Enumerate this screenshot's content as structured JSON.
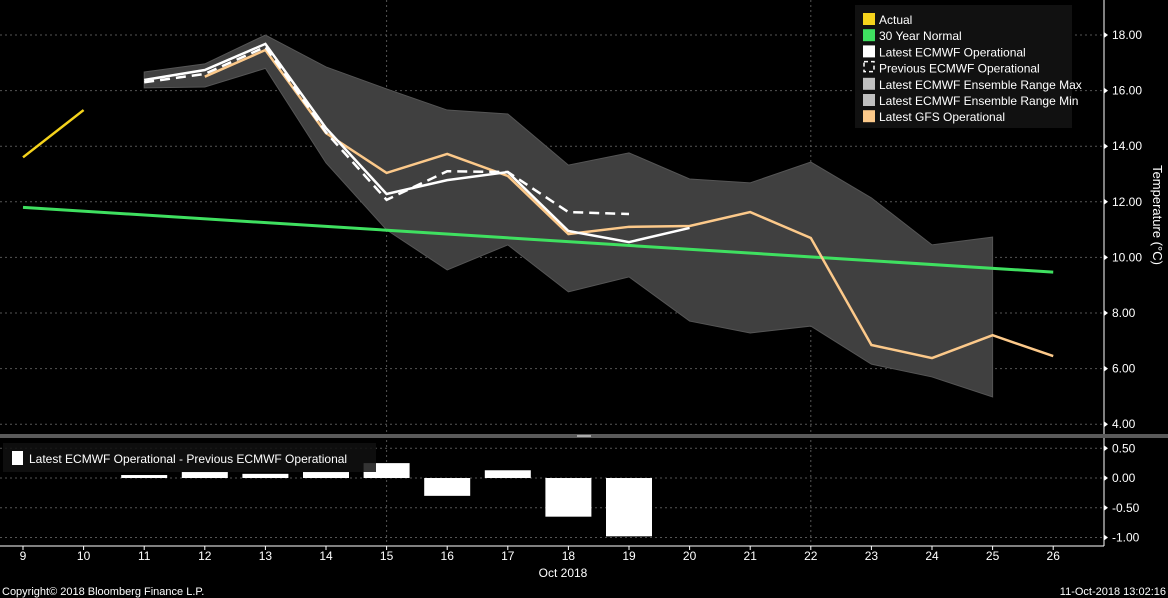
{
  "chart_data": [
    {
      "type": "line",
      "title": "",
      "ylabel": "Temperature (°C)",
      "ylim": [
        3.6,
        18.8
      ],
      "yticks": [
        "18.00",
        "16.00",
        "14.00",
        "12.00",
        "10.00",
        "8.00",
        "6.00",
        "4.00"
      ],
      "ytick_values": [
        18,
        16,
        14,
        12,
        10,
        8,
        6,
        4
      ],
      "legend_position": "top-right",
      "grid": true,
      "series": [
        {
          "name": "Actual",
          "color": "#f5d31c",
          "x": [
            9,
            10
          ],
          "values": [
            13.6,
            15.3
          ]
        },
        {
          "name": "30 Year Normal",
          "color": "#3fe060",
          "x": [
            9,
            26
          ],
          "values": [
            11.8,
            9.47
          ]
        },
        {
          "name": "Latest ECMWF Operational",
          "color": "#ffffff",
          "x": [
            11,
            12,
            13,
            14,
            15,
            16,
            17,
            18,
            19,
            20
          ],
          "values": [
            16.38,
            16.74,
            17.68,
            14.65,
            12.28,
            12.78,
            13.07,
            10.95,
            10.55,
            11.06
          ]
        },
        {
          "name": "Previous ECMWF Operational",
          "color": "#ffffff",
          "dashed": true,
          "x": [
            11,
            12,
            13,
            14,
            15,
            16,
            17,
            18,
            19
          ],
          "values": [
            16.3,
            16.6,
            17.57,
            14.5,
            12.07,
            13.1,
            13.07,
            11.63,
            11.56
          ]
        },
        {
          "name": "Latest ECMWF Ensemble Range Max",
          "color": "#c0c0c0",
          "x": [
            11,
            12,
            13,
            14,
            15,
            16,
            17,
            18,
            19,
            20,
            21,
            22,
            23,
            24,
            25
          ],
          "values": [
            16.67,
            16.96,
            18.0,
            16.85,
            16.06,
            15.3,
            15.16,
            13.32,
            13.76,
            12.82,
            12.68,
            13.43,
            12.14,
            10.45,
            10.73
          ]
        },
        {
          "name": "Latest ECMWF Ensemble Range Min",
          "color": "#c0c0c0",
          "x": [
            11,
            12,
            13,
            14,
            15,
            16,
            17,
            18,
            19,
            20,
            21,
            22,
            23,
            24,
            25
          ],
          "values": [
            16.1,
            16.13,
            16.8,
            13.4,
            10.99,
            9.55,
            10.45,
            8.76,
            9.3,
            7.71,
            7.28,
            7.53,
            6.16,
            5.7,
            4.98
          ]
        },
        {
          "name": "Latest GFS Operational",
          "color": "#fcc98a",
          "x": [
            12,
            13,
            14,
            15,
            16,
            17,
            18,
            19,
            20,
            21,
            22,
            23,
            24,
            25,
            26
          ],
          "values": [
            16.5,
            17.46,
            14.47,
            13.04,
            13.72,
            12.93,
            10.84,
            11.1,
            11.13,
            11.63,
            10.7,
            6.85,
            6.38,
            7.2,
            6.45
          ]
        }
      ]
    },
    {
      "type": "bar",
      "legend": "Latest ECMWF Operational - Previous ECMWF Operational",
      "ylim": [
        -1.15,
        0.55
      ],
      "yticks": [
        "0.50",
        "0.00",
        "-0.50",
        "-1.00"
      ],
      "ytick_values": [
        0.5,
        0,
        -0.5,
        -1
      ],
      "x": [
        11,
        12,
        13,
        14,
        15,
        16,
        17,
        18,
        19
      ],
      "values": [
        0.05,
        0.1,
        0.07,
        0.1,
        0.25,
        -0.3,
        0.13,
        -0.65,
        -0.98
      ],
      "color": "#ffffff"
    }
  ],
  "xaxis": {
    "ticks": [
      "9",
      "10",
      "11",
      "12",
      "13",
      "14",
      "15",
      "16",
      "17",
      "18",
      "19",
      "20",
      "21",
      "22",
      "23",
      "24",
      "25",
      "26"
    ],
    "tick_values": [
      9,
      10,
      11,
      12,
      13,
      14,
      15,
      16,
      17,
      18,
      19,
      20,
      21,
      22,
      23,
      24,
      25,
      26
    ],
    "label": "Oct 2018"
  },
  "footer": {
    "copyright": "Copyright© 2018 Bloomberg Finance L.P.",
    "timestamp": "11-Oct-2018 13:02:16"
  }
}
